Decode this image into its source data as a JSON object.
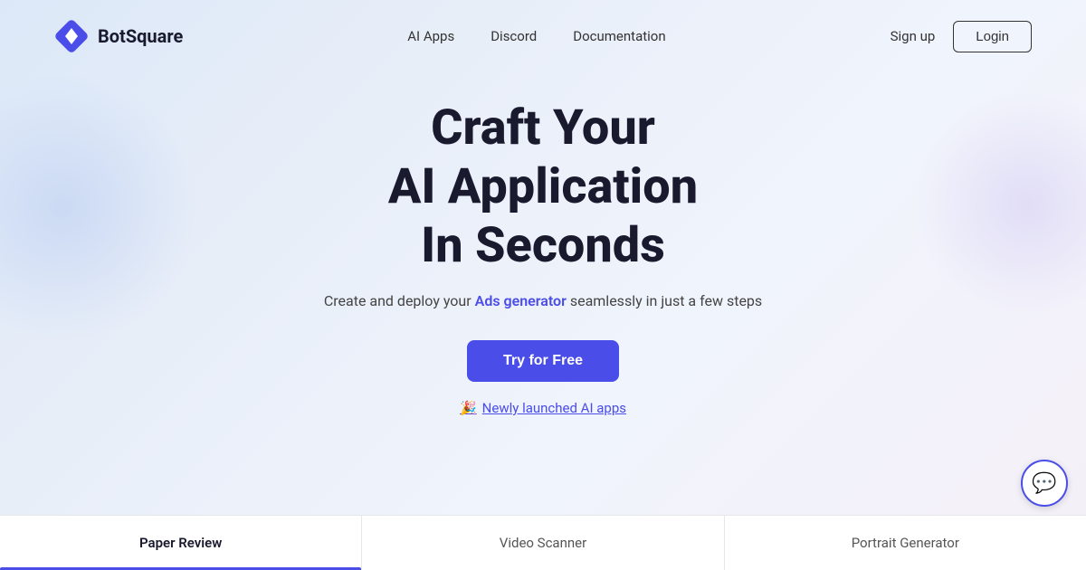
{
  "brand": {
    "logo_text": "BotSquare",
    "logo_icon": "diamond-icon"
  },
  "navbar": {
    "links": [
      {
        "label": "AI Apps",
        "name": "nav-ai-apps"
      },
      {
        "label": "Discord",
        "name": "nav-discord"
      },
      {
        "label": "Documentation",
        "name": "nav-documentation"
      }
    ],
    "sign_up_label": "Sign up",
    "login_label": "Login"
  },
  "hero": {
    "title_line1": "Craft Your",
    "title_line2": "AI Application",
    "title_line3": "In Seconds",
    "subtitle_prefix": "Create and deploy your ",
    "subtitle_highlight": "Ads generator",
    "subtitle_suffix": " seamlessly in just a few steps",
    "cta_label": "Try for Free",
    "new_apps_emoji": "🎉",
    "new_apps_label": "Newly launched AI apps"
  },
  "tabs": [
    {
      "label": "Paper Review",
      "active": true
    },
    {
      "label": "Video Scanner",
      "active": false
    },
    {
      "label": "Portrait Generator",
      "active": false
    }
  ],
  "chat_bubble": {
    "icon": "💬"
  }
}
